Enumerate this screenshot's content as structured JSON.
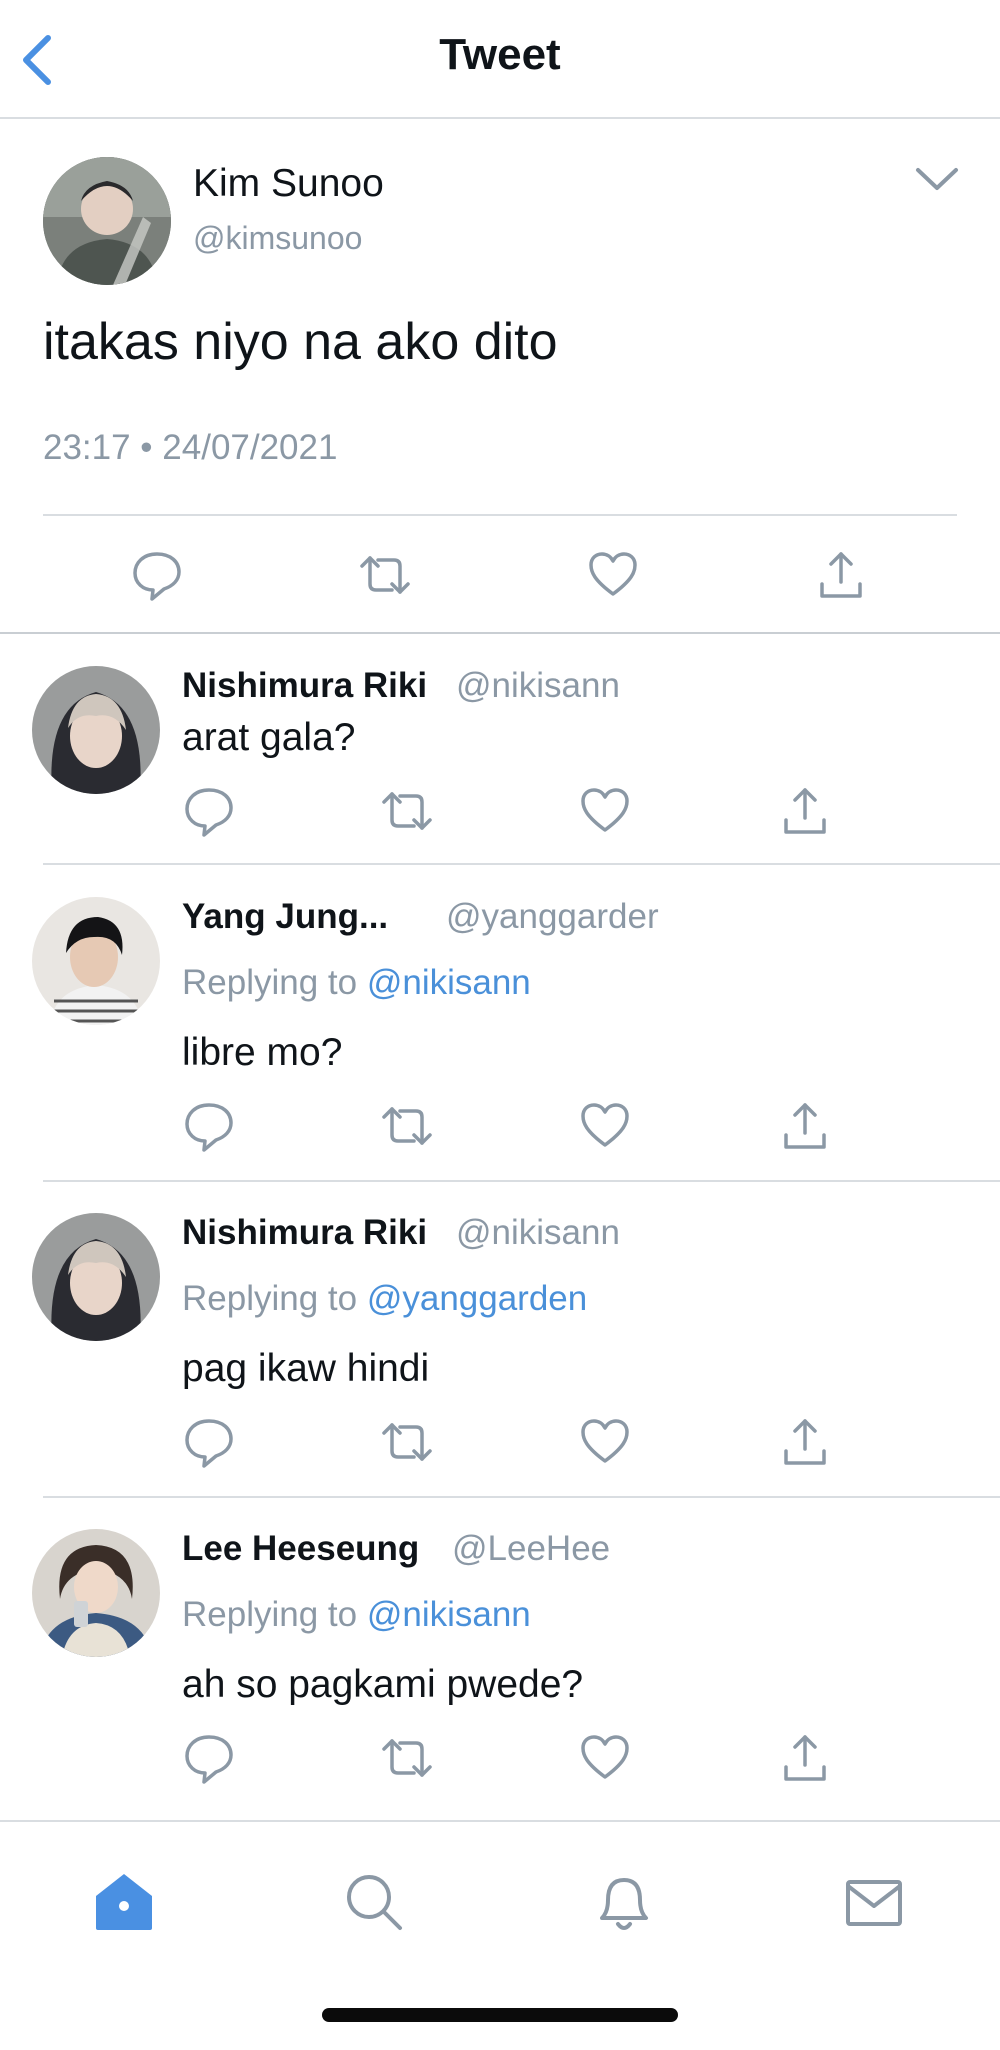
{
  "header": {
    "title": "Tweet",
    "back_icon": "chevron-left-icon"
  },
  "main_tweet": {
    "name": "Kim Sunoo",
    "handle": "@kimsunoo",
    "text": "itakas niyo na ako dito",
    "timestamp": "23:17 • 24/07/2021"
  },
  "replies": [
    {
      "name": "Nishimura Riki",
      "handle": "@nikisann",
      "replying_prefix": "",
      "replying_to": "",
      "text": "arat gala?"
    },
    {
      "name": "Yang Jung...",
      "handle": "@yanggarder",
      "replying_prefix": "Replying to ",
      "replying_to": "@nikisann",
      "text": "libre mo?"
    },
    {
      "name": "Nishimura Riki",
      "handle": "@nikisann",
      "replying_prefix": "Replying to ",
      "replying_to": "@yanggarden",
      "text": "pag ikaw hindi"
    },
    {
      "name": "Lee Heeseung",
      "handle": "@LeeHee",
      "replying_prefix": "Replying to ",
      "replying_to": "@nikisann",
      "text": "ah so pagkami pwede?"
    }
  ],
  "tabbar": {
    "items": [
      "home-icon",
      "search-icon",
      "bell-icon",
      "mail-icon"
    ],
    "active": "home-icon"
  },
  "colors": {
    "accent": "#4a90e2",
    "muted": "#8b98a5",
    "text": "#0f1419",
    "divider": "#d9dde1"
  }
}
